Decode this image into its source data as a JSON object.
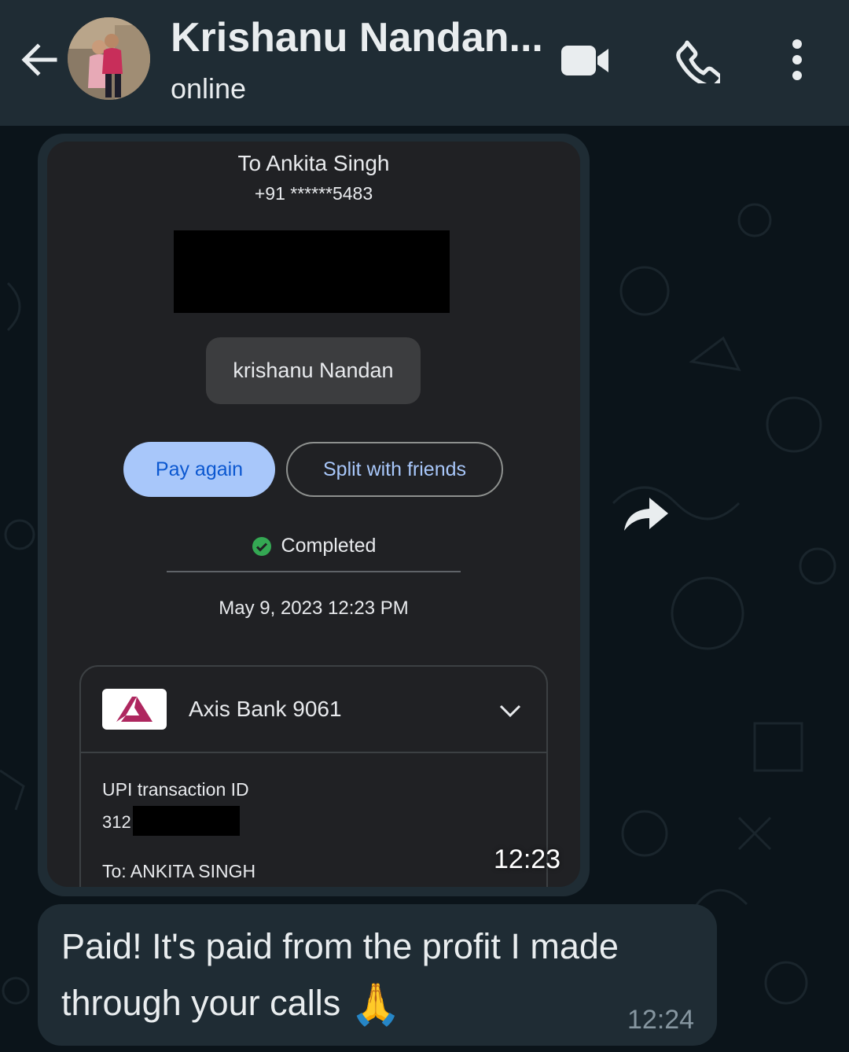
{
  "header": {
    "contact_name": "Krishanu Nandan...",
    "status": "online"
  },
  "payment_screenshot": {
    "to_name": "To Ankita Singh",
    "to_phone": "+91 ******5483",
    "payer": "krishanu Nandan",
    "pay_again": "Pay again",
    "split": "Split with friends",
    "status": "Completed",
    "datetime": "May 9, 2023 12:23 PM",
    "bank": "Axis Bank 9061",
    "upi_label": "UPI transaction ID",
    "upi_value_visible": "312",
    "to_label": "To: ANKITA  SINGH"
  },
  "messages": [
    {
      "type": "image",
      "time": "12:23"
    },
    {
      "type": "text",
      "text": "Paid! It's paid from the profit I made through your calls",
      "emoji": "🙏",
      "time": "12:24"
    }
  ],
  "colors": {
    "header_bg": "#1f2c34",
    "chat_bg": "#0b141a",
    "bubble_bg": "#1f2c34",
    "accent_blue": "#a8c7fa",
    "success_green": "#34a853"
  }
}
